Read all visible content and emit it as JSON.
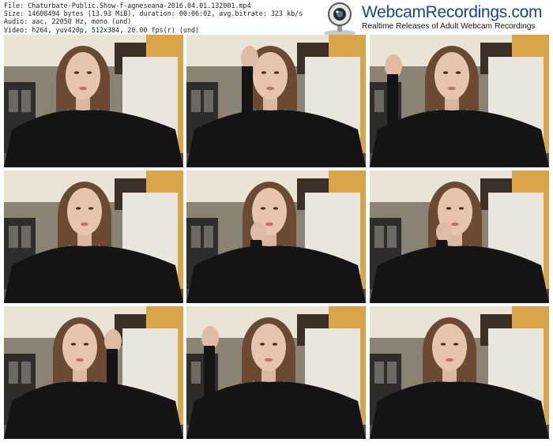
{
  "file_info": {
    "line1": "File: Chaturbate-Public.Show-f-agneseana-2016.04.01.132001.mp4",
    "line2": "Size: 14608494 bytes (13.93 MiB), duration: 00:06:02, avg.bitrate: 323 kb/s",
    "line3": "Audio: aac, 22050 Hz, mono (und)",
    "line4": "Video: h264, yuv420p, 512x384, 20.00 fps(r) (und)"
  },
  "logo": {
    "title": "WebcamRecordings.com",
    "tagline": "Realtime Releases of Adult Webcam Recordings",
    "icon": "webcam-icon",
    "color": "#16458a"
  },
  "thumbnails": [
    {
      "pose": "neutral"
    },
    {
      "pose": "hand-on-head"
    },
    {
      "pose": "hand-raised"
    },
    {
      "pose": "neutral"
    },
    {
      "pose": "hand-at-chin"
    },
    {
      "pose": "hand-at-chin"
    },
    {
      "pose": "hand-waving"
    },
    {
      "pose": "hand-raised"
    },
    {
      "pose": "neutral"
    }
  ]
}
